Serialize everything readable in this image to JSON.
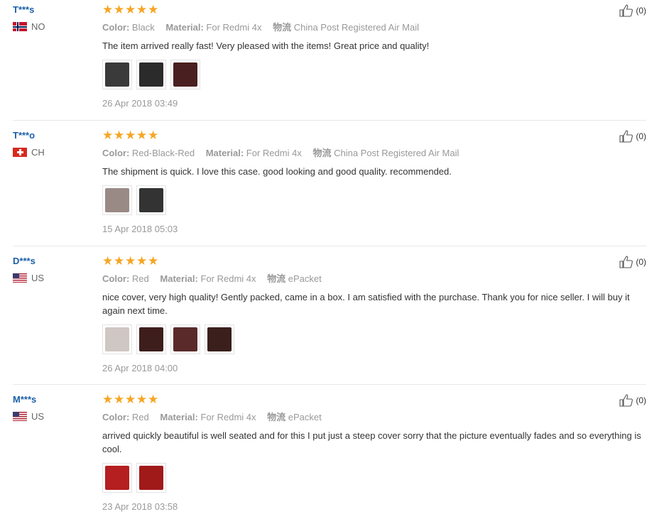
{
  "reviews": [
    {
      "user": "T***s",
      "country": "NO",
      "flag": "norway-flag-icon",
      "rating": 5,
      "attrs": [
        {
          "key": "Color:",
          "value": "Black"
        },
        {
          "key": "Material:",
          "value": "For Redmi 4x"
        },
        {
          "key": "物流",
          "value": "China Post Registered Air Mail"
        }
      ],
      "text": "The item arrived really fast! Very pleased with the items! Great price and quality!",
      "photos": 3,
      "photo_colors": [
        "#3a3a3a",
        "#2b2b2b",
        "#4a1f1f"
      ],
      "date": "26 Apr 2018 03:49",
      "likes": "(0)"
    },
    {
      "user": "T***o",
      "country": "CH",
      "flag": "switzerland-flag-icon",
      "rating": 5,
      "attrs": [
        {
          "key": "Color:",
          "value": "Red-Black-Red"
        },
        {
          "key": "Material:",
          "value": "For Redmi 4x"
        },
        {
          "key": "物流",
          "value": "China Post Registered Air Mail"
        }
      ],
      "text": "The shipment is quick. I love this case. good looking and good quality. recommended.",
      "photos": 2,
      "photo_colors": [
        "#9a8a86",
        "#333333"
      ],
      "date": "15 Apr 2018 05:03",
      "likes": "(0)"
    },
    {
      "user": "D***s",
      "country": "US",
      "flag": "usa-flag-icon",
      "rating": 5,
      "attrs": [
        {
          "key": "Color:",
          "value": "Red"
        },
        {
          "key": "Material:",
          "value": "For Redmi 4x"
        },
        {
          "key": "物流",
          "value": "ePacket"
        }
      ],
      "text": "nice cover, very high quality! Gently packed, came in a box. I am satisfied with the purchase. Thank you for nice seller. I will buy it again next time.",
      "photos": 4,
      "photo_colors": [
        "#cfc7c4",
        "#3d1e1c",
        "#5a2a2a",
        "#3a1f1c"
      ],
      "date": "26 Apr 2018 04:00",
      "likes": "(0)"
    },
    {
      "user": "M***s",
      "country": "US",
      "flag": "usa-flag-icon",
      "rating": 5,
      "attrs": [
        {
          "key": "Color:",
          "value": "Red"
        },
        {
          "key": "Material:",
          "value": "For Redmi 4x"
        },
        {
          "key": "物流",
          "value": "ePacket"
        }
      ],
      "text": "arrived quickly beautiful is well seated and for this I put just a steep cover sorry that the picture eventually fades and so everything is cool.",
      "photos": 2,
      "photo_colors": [
        "#b51f1f",
        "#a11a1a"
      ],
      "date": "23 Apr 2018 03:58",
      "likes": "(0)"
    }
  ],
  "colors": {
    "star": "#f5a623",
    "username": "#1a5fa8",
    "muted": "#999999"
  }
}
